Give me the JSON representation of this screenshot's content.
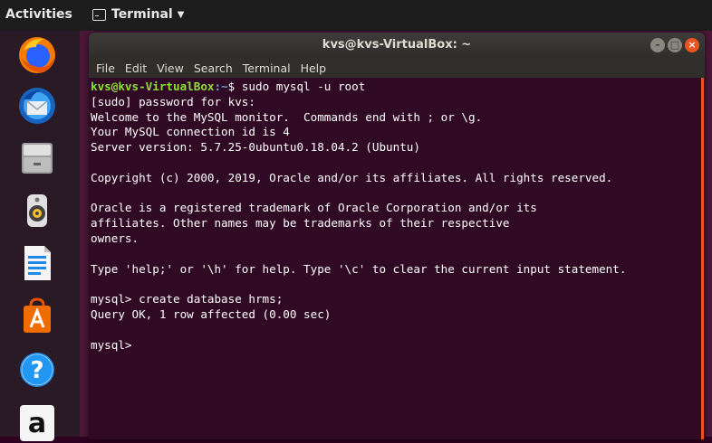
{
  "topbar": {
    "activities": "Activities",
    "app_menu_label": "Terminal",
    "app_menu_icon": "terminal-icon"
  },
  "dock": {
    "items": [
      {
        "name": "firefox",
        "icon": "firefox-icon"
      },
      {
        "name": "thunderbird",
        "icon": "thunderbird-icon"
      },
      {
        "name": "files",
        "icon": "files-icon"
      },
      {
        "name": "rhythmbox",
        "icon": "rhythmbox-icon"
      },
      {
        "name": "libreoffice-writer",
        "icon": "writer-icon"
      },
      {
        "name": "ubuntu-software",
        "icon": "software-icon"
      },
      {
        "name": "help",
        "icon": "help-icon"
      },
      {
        "name": "amazon",
        "icon": "amazon-icon"
      }
    ]
  },
  "window": {
    "title": "kvs@kvs-VirtualBox: ~",
    "menu": [
      "File",
      "Edit",
      "View",
      "Search",
      "Terminal",
      "Help"
    ]
  },
  "terminal": {
    "prompt_user": "kvs@kvs-VirtualBox",
    "prompt_path": ":~",
    "command": "$ sudo mysql -u root",
    "output_lines": [
      "[sudo] password for kvs:",
      "Welcome to the MySQL monitor.  Commands end with ; or \\g.",
      "Your MySQL connection id is 4",
      "Server version: 5.7.25-0ubuntu0.18.04.2 (Ubuntu)",
      "",
      "Copyright (c) 2000, 2019, Oracle and/or its affiliates. All rights reserved.",
      "",
      "Oracle is a registered trademark of Oracle Corporation and/or its",
      "affiliates. Other names may be trademarks of their respective",
      "owners.",
      "",
      "Type 'help;' or '\\h' for help. Type '\\c' to clear the current input statement.",
      "",
      "mysql> create database hrms;",
      "Query OK, 1 row affected (0.00 sec)",
      "",
      "mysql> "
    ]
  },
  "colors": {
    "terminal_bg": "#300a24",
    "prompt_user": "#8ae234",
    "prompt_path": "#729fcf",
    "accent": "#e95420"
  }
}
